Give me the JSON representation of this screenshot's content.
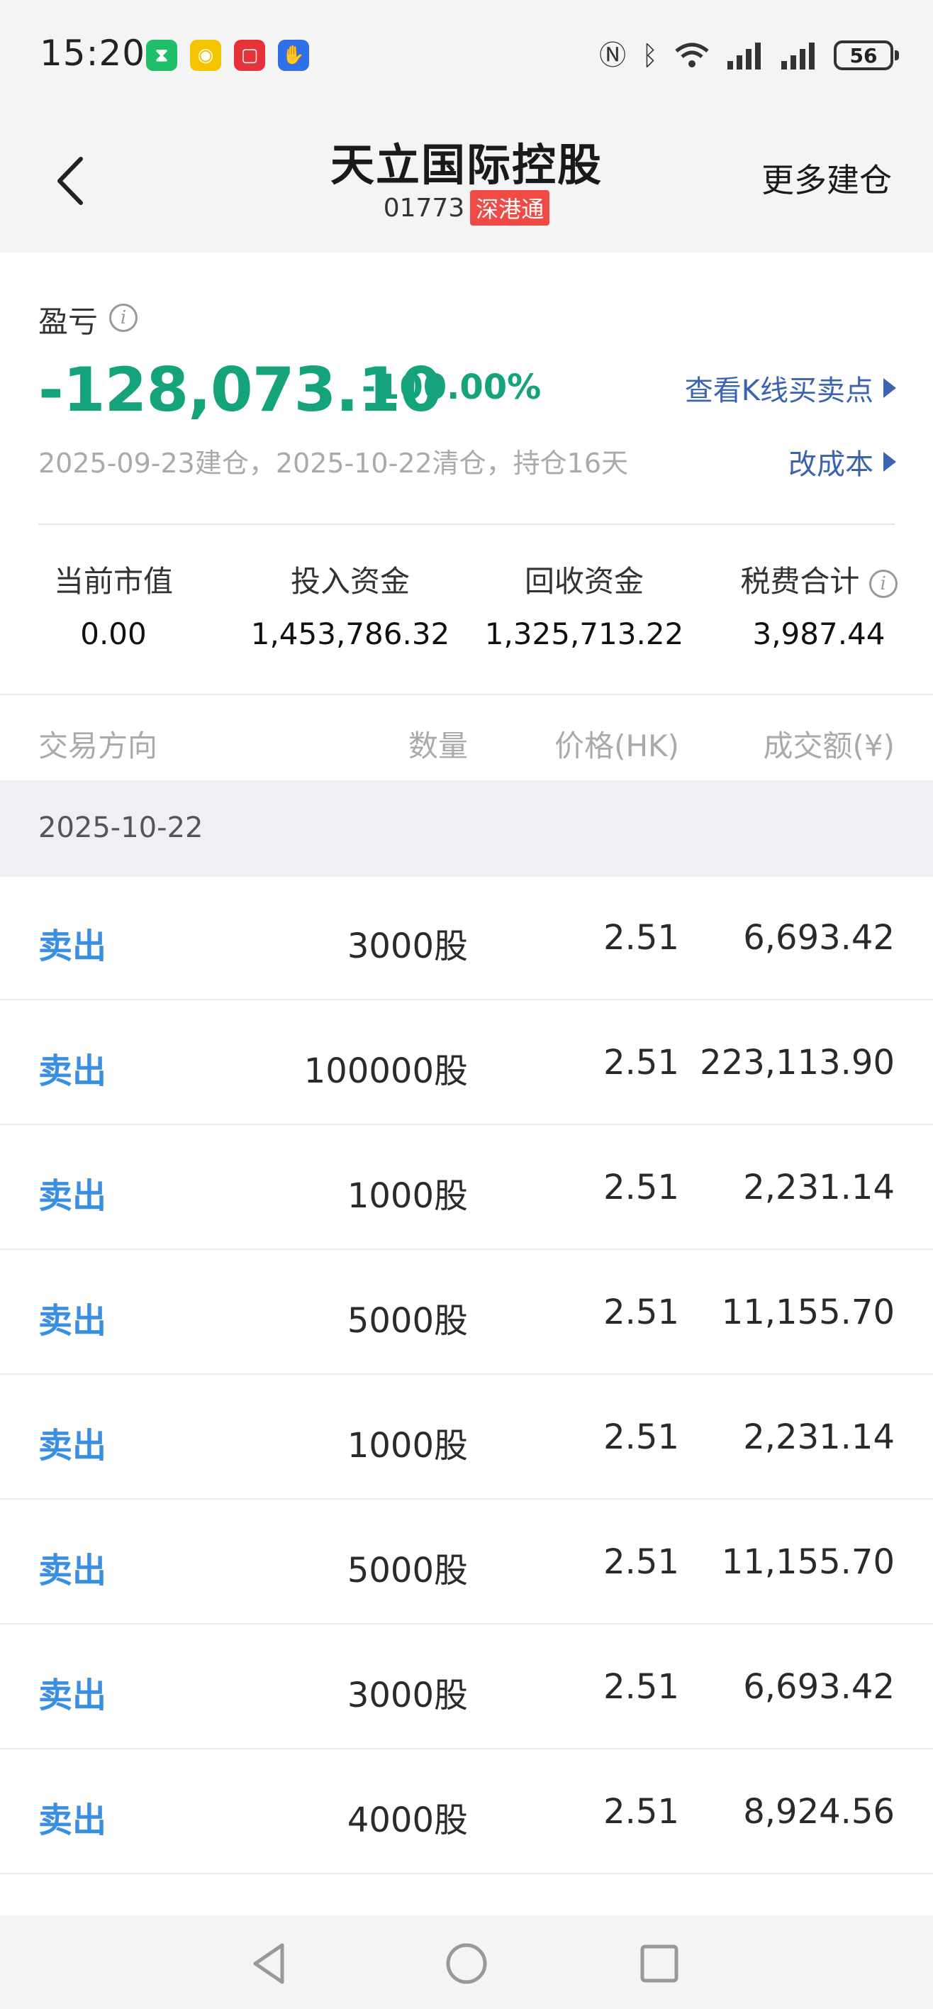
{
  "status_bar": {
    "time": "15:20",
    "battery": "56",
    "app_icons": [
      "timer-app-icon",
      "weibo-icon",
      "red-app-icon",
      "blue-app-icon"
    ],
    "indicators": [
      "nfc-icon",
      "bluetooth-icon",
      "wifi-icon",
      "signal-icon",
      "signal-icon"
    ]
  },
  "header": {
    "title": "天立国际控股",
    "code": "01773",
    "tag": "深港通",
    "more_label": "更多建仓"
  },
  "summary": {
    "pnl_label": "盈亏",
    "pnl_value": "-128,073.10",
    "pnl_percent": "-100.00%",
    "kline_link": "查看K线买卖点",
    "cost_link": "改成本",
    "dates": "2025-09-23建仓，2025-10-22清仓，持仓16天",
    "stats": [
      {
        "label": "当前市值",
        "value": "0.00"
      },
      {
        "label": "投入资金",
        "value": "1,453,786.32"
      },
      {
        "label": "回收资金",
        "value": "1,325,713.22"
      },
      {
        "label": "税费合计",
        "value": "3,987.44"
      }
    ]
  },
  "table": {
    "headers": {
      "direction": "交易方向",
      "quantity": "数量",
      "price": "价格(HK)",
      "amount": "成交额(¥)"
    },
    "group_date": "2025-10-22",
    "rows": [
      {
        "direction": "卖出",
        "quantity": "3000股",
        "price": "2.51",
        "amount": "6,693.42"
      },
      {
        "direction": "卖出",
        "quantity": "100000股",
        "price": "2.51",
        "amount": "223,113.90"
      },
      {
        "direction": "卖出",
        "quantity": "1000股",
        "price": "2.51",
        "amount": "2,231.14"
      },
      {
        "direction": "卖出",
        "quantity": "5000股",
        "price": "2.51",
        "amount": "11,155.70"
      },
      {
        "direction": "卖出",
        "quantity": "1000股",
        "price": "2.51",
        "amount": "2,231.14"
      },
      {
        "direction": "卖出",
        "quantity": "5000股",
        "price": "2.51",
        "amount": "11,155.70"
      },
      {
        "direction": "卖出",
        "quantity": "3000股",
        "price": "2.51",
        "amount": "6,693.42"
      },
      {
        "direction": "卖出",
        "quantity": "4000股",
        "price": "2.51",
        "amount": "8,924.56"
      }
    ]
  },
  "colors": {
    "loss_green": "#14a37a",
    "link_blue": "#3b63b0",
    "sell_blue": "#3a8fe0",
    "tag_red": "#f04a44"
  }
}
